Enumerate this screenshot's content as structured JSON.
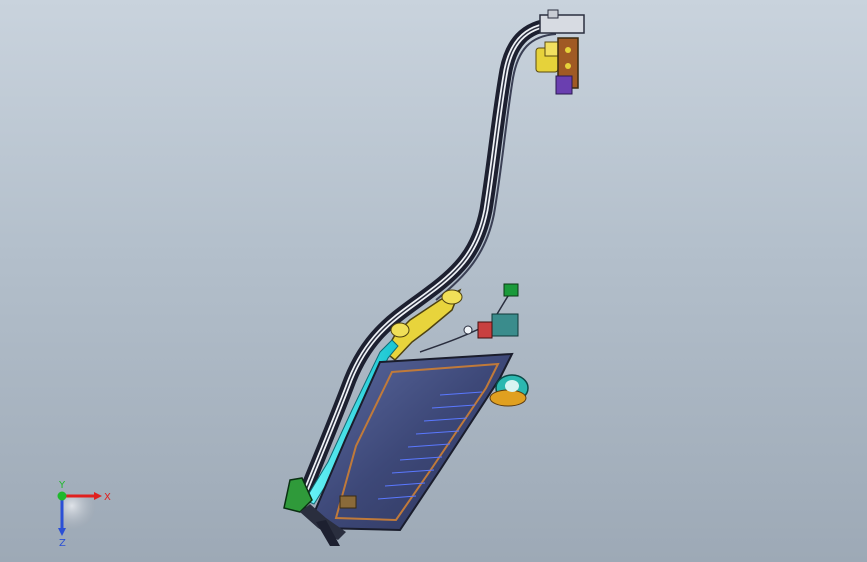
{
  "viewport": {
    "background_top": "#c9d3dd",
    "background_bottom": "#9da9b6"
  },
  "triad": {
    "x_label": "X",
    "y_label": "Y",
    "z_label": "Z",
    "x_color": "#e0201e",
    "y_color": "#1fb82c",
    "z_color": "#2a4fd6"
  },
  "model": {
    "rail_color": "#2a2e3e",
    "glass_color": "#4b5a8a",
    "seal_color": "#2ee0e6",
    "bracket_color": "#e6d23a",
    "motor_color": "#2bb8b0"
  }
}
